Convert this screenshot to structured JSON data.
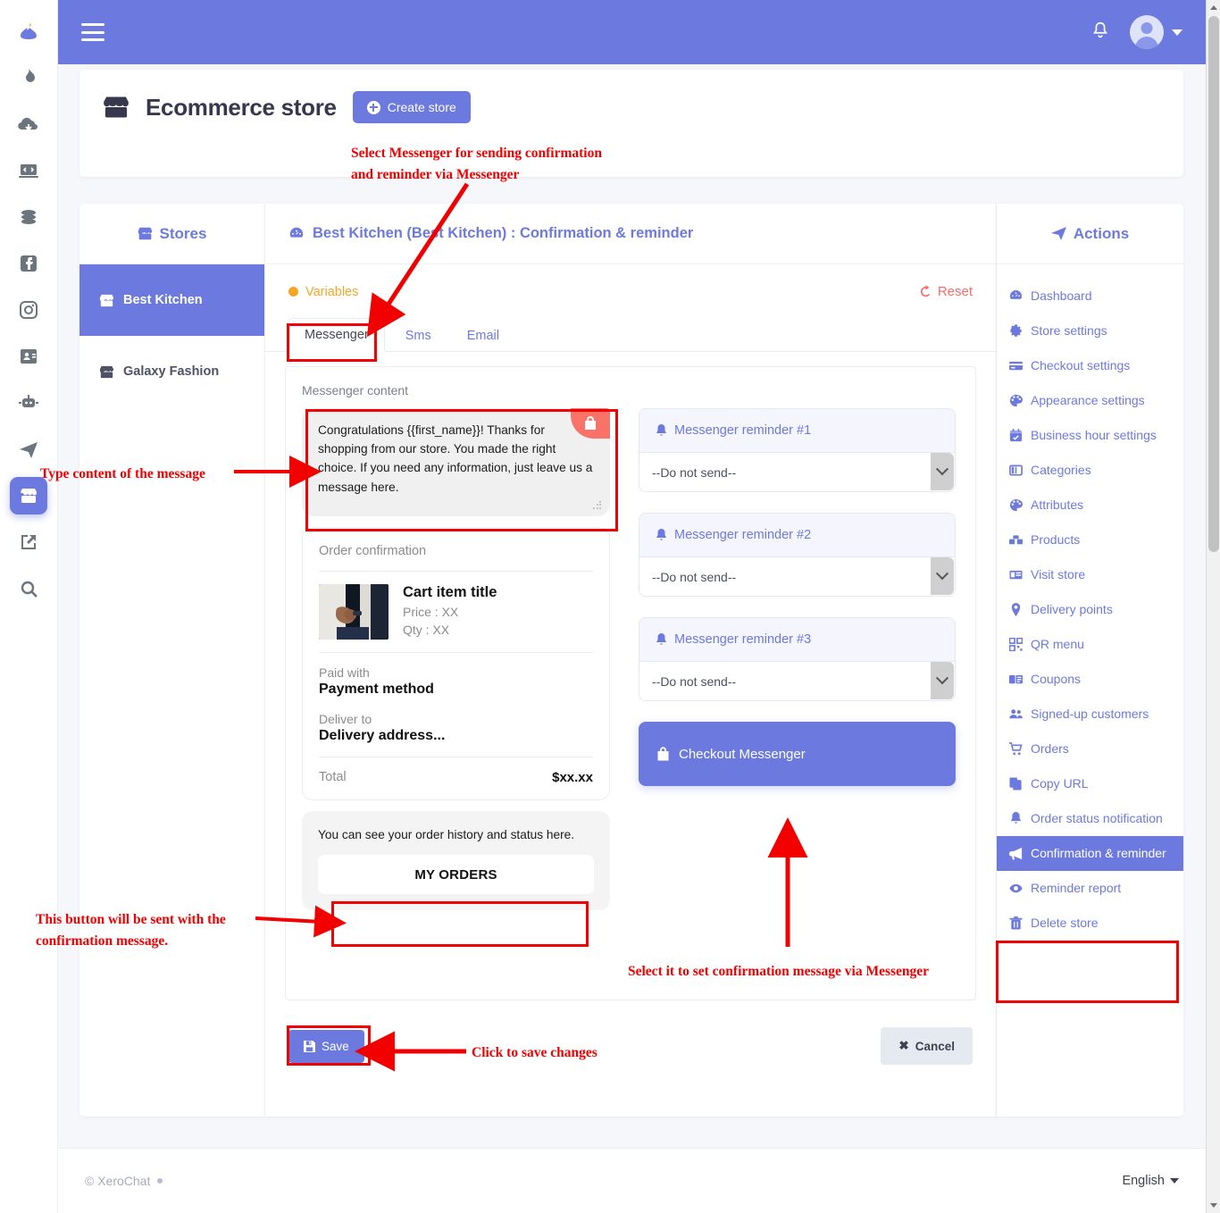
{
  "navbar": {
    "menu_label": "menu",
    "bell_label": "Notifications",
    "account_label": "Account"
  },
  "header": {
    "title": "Ecommerce store",
    "create_store_label": "Create store"
  },
  "stores_panel": {
    "heading": "Stores",
    "items": [
      {
        "label": "Best Kitchen",
        "active": true
      },
      {
        "label": "Galaxy Fashion",
        "active": false
      }
    ]
  },
  "main": {
    "heading": "Best Kitchen (Best Kitchen) : Confirmation & reminder",
    "variables_label": "Variables",
    "reset_label": "Reset",
    "tabs": [
      {
        "label": "Messenger",
        "active": true
      },
      {
        "label": "Sms",
        "active": false
      },
      {
        "label": "Email",
        "active": false
      }
    ],
    "messenger_content_label": "Messenger content",
    "message_text": "Congratulations {{first_name}}!\nThanks for shopping from our store. You made the right choice. If you need any information, just leave us a message here.",
    "receipt": {
      "title": "Order confirmation",
      "item_title": "Cart item title",
      "price": "Price : XX",
      "qty": "Qty : XX",
      "paid_with_label": "Paid with",
      "paid_with_value": "Payment method",
      "deliver_to_label": "Deliver to",
      "deliver_to_value": "Delivery address...",
      "total_label": "Total",
      "total_value": "$xx.xx"
    },
    "orders_card": {
      "text": "You can see your order history and status here.",
      "button_label": "MY ORDERS"
    },
    "reminders": [
      {
        "title": "Messenger reminder #1",
        "value": "--Do not send--"
      },
      {
        "title": "Messenger reminder #2",
        "value": "--Do not send--"
      },
      {
        "title": "Messenger reminder #3",
        "value": "--Do not send--"
      }
    ],
    "checkout_button_label": "Checkout Messenger",
    "save_label": "Save",
    "cancel_label": "Cancel"
  },
  "actions_panel": {
    "heading": "Actions",
    "items": [
      {
        "label": "Dashboard",
        "icon": "dashboard-icon",
        "active": false
      },
      {
        "label": "Store settings",
        "icon": "gear-icon",
        "active": false
      },
      {
        "label": "Checkout settings",
        "icon": "card-icon",
        "active": false
      },
      {
        "label": "Appearance settings",
        "icon": "palette-icon",
        "active": false
      },
      {
        "label": "Business hour settings",
        "icon": "calendar-icon",
        "active": false
      },
      {
        "label": "Categories",
        "icon": "columns-icon",
        "active": false
      },
      {
        "label": "Attributes",
        "icon": "palette-icon",
        "active": false
      },
      {
        "label": "Products",
        "icon": "boxes-icon",
        "active": false
      },
      {
        "label": "Visit store",
        "icon": "window-icon",
        "active": false
      },
      {
        "label": "Delivery points",
        "icon": "map-pin-icon",
        "active": false
      },
      {
        "label": "QR menu",
        "icon": "qr-icon",
        "active": false
      },
      {
        "label": "Coupons",
        "icon": "coupon-icon",
        "active": false
      },
      {
        "label": "Signed-up customers",
        "icon": "users-icon",
        "active": false
      },
      {
        "label": "Orders",
        "icon": "cart-icon",
        "active": false
      },
      {
        "label": "Copy URL",
        "icon": "copy-icon",
        "active": false
      },
      {
        "label": "Order status notification",
        "icon": "bell-icon",
        "active": false
      },
      {
        "label": "Confirmation & reminder",
        "icon": "megaphone-icon",
        "active": true
      },
      {
        "label": "Reminder report",
        "icon": "eye-icon",
        "active": false
      },
      {
        "label": "Delete store",
        "icon": "trash-icon",
        "active": false
      }
    ]
  },
  "footer": {
    "copyright": "© XeroChat",
    "language": "English"
  },
  "annotations": [
    {
      "id": "anno-messenger-tab",
      "text": "Select Messenger for sending confirmation\nand reminder via Messenger"
    },
    {
      "id": "anno-message-content",
      "text": "Type content of the message"
    },
    {
      "id": "anno-my-orders",
      "text": "This button will be sent with the\nconfirmation message."
    },
    {
      "id": "anno-checkout-messenger",
      "text": "Select it to set confirmation message via Messenger"
    },
    {
      "id": "anno-save",
      "text": "Click to save changes"
    }
  ],
  "colors": {
    "accent": "#6c7ae0",
    "annotation": "#f20000",
    "warning": "#f5a623",
    "danger": "#fd6a6a"
  }
}
